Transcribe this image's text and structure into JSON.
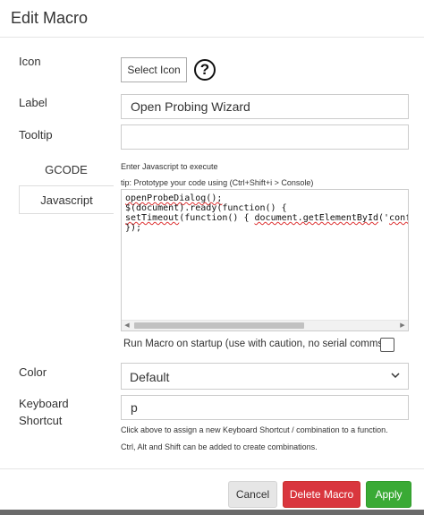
{
  "dialog": {
    "title": "Edit Macro"
  },
  "form": {
    "icon_label": "Icon",
    "select_icon_button": "Select Icon",
    "help_icon_glyph": "?",
    "label_label": "Label",
    "label_value": "Open Probing Wizard",
    "tooltip_label": "Tooltip",
    "tooltip_value": "",
    "tabs": [
      {
        "label": "GCODE",
        "active": false
      },
      {
        "label": "Javascript",
        "active": true
      }
    ],
    "js_instruction": "Enter Javascript to execute",
    "js_tip": "tip: Prototype your code using (Ctrl+Shift+i > Console)",
    "code": {
      "line1": "openProbeDialog();",
      "line2": "$(document).ready(function() {",
      "line3_a": "setTimeout",
      "line3_b": "(function() { ",
      "line3_c": "document.getElementById",
      "line3_d": "('",
      "line3_e": "confirm",
      "line4": "});"
    },
    "run_on_startup_label": "Run Macro on startup (use with caution, no serial comms)",
    "run_on_startup_checked": false,
    "color_label": "Color",
    "color_value": "Default",
    "keyboard_label_line1": "Keyboard",
    "keyboard_label_line2": "Shortcut",
    "keyboard_value": "p",
    "keyboard_hint_line1": "Click above to assign a new Keyboard Shortcut / combination to a function.",
    "keyboard_hint_line2": "Ctrl, Alt and Shift can be added to create combinations."
  },
  "footer": {
    "cancel_label": "Cancel",
    "delete_label": "Delete Macro",
    "apply_label": "Apply"
  },
  "colors": {
    "delete_button": "#d9363e",
    "apply_button": "#3aaa35",
    "cancel_button": "#e6e6e6"
  },
  "icons": {
    "help": "question-circle-icon",
    "dropdown": "chevron-down-icon",
    "scroll_left": "arrow-left-icon",
    "scroll_right": "arrow-right-icon"
  }
}
